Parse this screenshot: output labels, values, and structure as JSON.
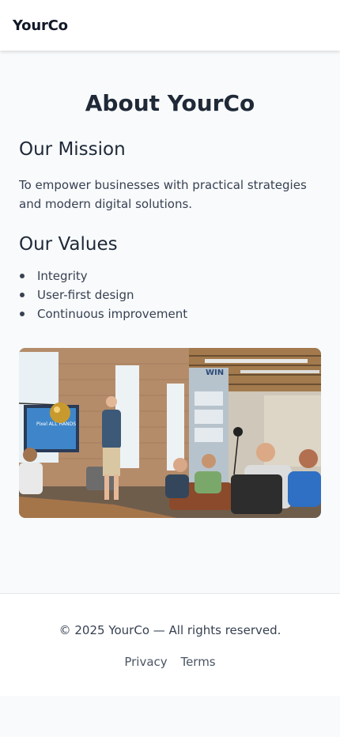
{
  "header": {
    "brand": "YourCo"
  },
  "main": {
    "title": "About YourCo",
    "mission": {
      "heading": "Our Mission",
      "text": "To empower businesses with practical strategies and modern digital solutions."
    },
    "values": {
      "heading": "Our Values",
      "items": [
        "Integrity",
        "User-first design",
        "Continuous improvement"
      ]
    },
    "image": {
      "description": "team meeting photo",
      "screen_text": "Pixel ALL HANDS",
      "wall_sign": "WIN"
    }
  },
  "footer": {
    "copyright": "© 2025 YourCo — All rights reserved.",
    "links": [
      "Privacy",
      "Terms"
    ]
  },
  "colors": {
    "background": "#f8fafc",
    "header_bg": "#ffffff",
    "text_dark": "#1f2937",
    "text_body": "#374151",
    "link": "#4b5563"
  }
}
